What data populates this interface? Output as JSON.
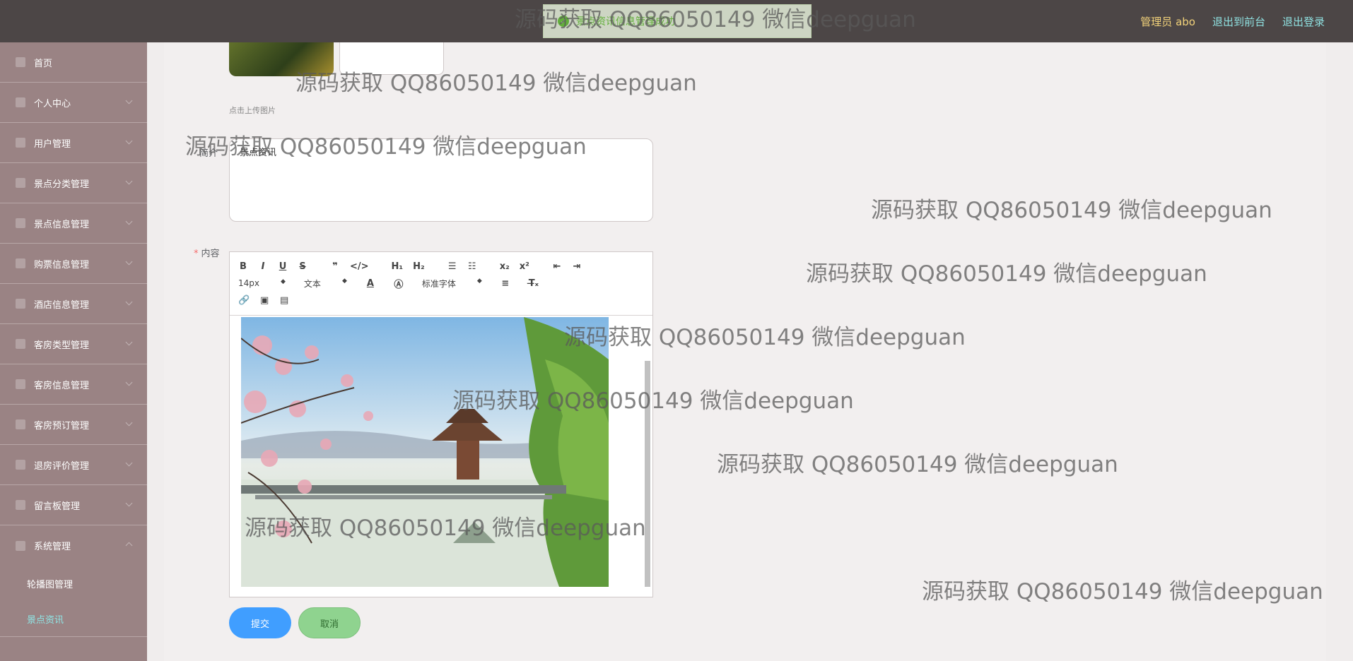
{
  "header": {
    "admin_label": "管理员 abo",
    "to_frontend": "退出到前台",
    "logout": "退出登录"
  },
  "toast": {
    "text": "景点资讯信息管理成功"
  },
  "sidebar": {
    "items": [
      {
        "label": "首页",
        "icon": "home-icon"
      },
      {
        "label": "个人中心",
        "icon": "user-icon"
      },
      {
        "label": "用户管理",
        "icon": "users-icon"
      },
      {
        "label": "景点分类管理",
        "icon": "category-icon"
      },
      {
        "label": "景点信息管理",
        "icon": "info-icon"
      },
      {
        "label": "购票信息管理",
        "icon": "ticket-icon"
      },
      {
        "label": "酒店信息管理",
        "icon": "hotel-icon"
      },
      {
        "label": "客房类型管理",
        "icon": "room-type-icon"
      },
      {
        "label": "客房信息管理",
        "icon": "room-icon"
      },
      {
        "label": "客房预订管理",
        "icon": "booking-icon"
      },
      {
        "label": "退房评价管理",
        "icon": "review-icon"
      },
      {
        "label": "留言板管理",
        "icon": "message-icon"
      },
      {
        "label": "系统管理",
        "icon": "system-icon"
      }
    ],
    "sub_items": [
      {
        "label": "轮播图管理",
        "active": false
      },
      {
        "label": "景点资讯",
        "active": true
      }
    ]
  },
  "form": {
    "upload_hint": "点击上传图片",
    "summary_label": "简介",
    "summary_value": "景点资讯",
    "content_label": "内容",
    "toolbar": {
      "font_size": "14px",
      "paragraph": "文本",
      "font_family": "标准字体"
    },
    "submit": "提交",
    "cancel": "取消"
  },
  "watermark": "源码获取 QQ86050149 微信deepguan"
}
